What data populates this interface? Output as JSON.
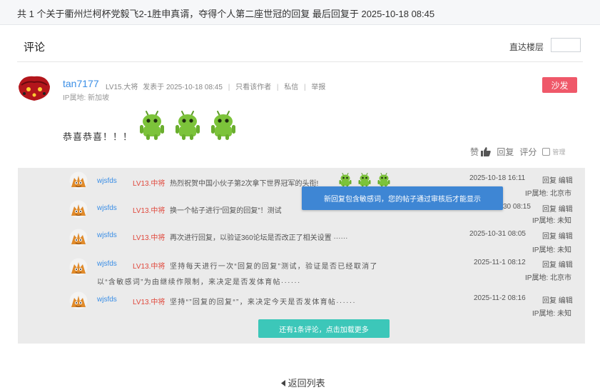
{
  "topbar": {
    "text": "共 1 个关于衢州烂柯杯党毅飞2-1胜申真谞，夺得个人第二座世冠的回复 最后回复于 2025-10-18 08:45"
  },
  "comments_header": {
    "title": "评论",
    "jump_label": "直达楼层",
    "jump_value": ""
  },
  "post": {
    "username": "tan7177",
    "level": "LV15.大将",
    "posted": "发表于 2025-10-18 08:45",
    "only_author": "只看该作者",
    "private_msg": "私信",
    "report": "举报",
    "ip": "IP属地: 新加坡",
    "sofa": "沙发",
    "text": "恭喜恭喜！！！",
    "emoji_icon": "android-icon"
  },
  "actions": {
    "like": "赞",
    "reply": "回复",
    "rate": "评分",
    "manage": "管理"
  },
  "replies": [
    {
      "user": "wjsfds",
      "level": "LV13.中将",
      "text": "热烈祝贺中国小伙子第2次拿下世界冠军的头衔!",
      "date": "2025-10-18 16:11",
      "reply": "回复",
      "edit": "编辑",
      "ip": "IP属地: 北京市"
    },
    {
      "user": "wjsfds",
      "level": "LV13.中将",
      "text": "换一个帖子进行“回复的回复”！测试",
      "date": "30 08:15",
      "reply": "回复",
      "edit": "编辑",
      "ip": "IP属地: 未知"
    },
    {
      "user": "wjsfds",
      "level": "LV13.中将",
      "text": "再次进行回复，以验证360论坛是否改正了相关设置 ······",
      "date": "2025-10-31 08:05",
      "reply": "回复",
      "edit": "编辑",
      "ip": "IP属地: 未知"
    },
    {
      "user": "wjsfds",
      "level": "LV13.中将",
      "text": "坚持每天进行一次“回复的回复”测试，验证是否已经取消了",
      "text2": "以“含敏感词”为由继续作限制，来决定是否发体育帖······",
      "date": "2025-11-1 08:12",
      "reply": "回复",
      "edit": "编辑",
      "ip": "IP属地: 北京市"
    },
    {
      "user": "wjsfds",
      "level": "LV13.中将",
      "text": "坚持“”回复的回复“”，来决定今天是否发体育帖······",
      "date": "2025-11-2 08:16",
      "reply": "回复",
      "edit": "编辑",
      "ip": "IP属地: 未知"
    }
  ],
  "tooltip": "新回复包含敏感词，您的帖子通过审核后才能显示",
  "load_more": "还有1条评论，点击加载更多",
  "back": "返回列表",
  "colors": {
    "link_blue": "#3a8ee6",
    "sofa_red": "#ef5869",
    "level_red": "#e0483c",
    "tooltip_blue": "#3e86d4",
    "load_more_teal": "#3cc7b9",
    "android_green": "#7cc33a"
  }
}
